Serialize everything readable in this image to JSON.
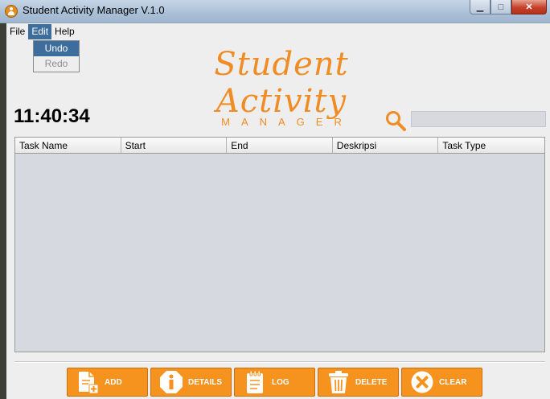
{
  "window": {
    "title": "Student Activity Manager V.1.0",
    "controls": {
      "minimize": "▁",
      "maximize": "□",
      "close": "✕"
    }
  },
  "menubar": {
    "items": [
      {
        "label": "File",
        "active": false
      },
      {
        "label": "Edit",
        "active": true
      },
      {
        "label": "Help",
        "active": false
      }
    ],
    "edit_dropdown": [
      {
        "label": "Undo",
        "state": "selected"
      },
      {
        "label": "Redo",
        "state": "disabled"
      }
    ]
  },
  "logo": {
    "main": "Student Activity",
    "sub": "MANAGER"
  },
  "clock": "11:40:34",
  "search": {
    "icon": "search-icon",
    "value": "",
    "placeholder": ""
  },
  "table": {
    "columns": [
      "Task Name",
      "Start",
      "End",
      "Deskripsi",
      "Task Type"
    ],
    "rows": []
  },
  "buttons": [
    {
      "label": "ADD",
      "icon": "add-document-icon"
    },
    {
      "label": "DETAILS",
      "icon": "info-icon"
    },
    {
      "label": "LOG",
      "icon": "log-notepad-icon"
    },
    {
      "label": "DELETE",
      "icon": "trash-icon"
    },
    {
      "label": "CLEAR",
      "icon": "clear-x-icon"
    }
  ],
  "colors": {
    "accent": "#f6921e",
    "menu_highlight": "#3d6d9c",
    "table_bg": "#d6d9e0"
  }
}
